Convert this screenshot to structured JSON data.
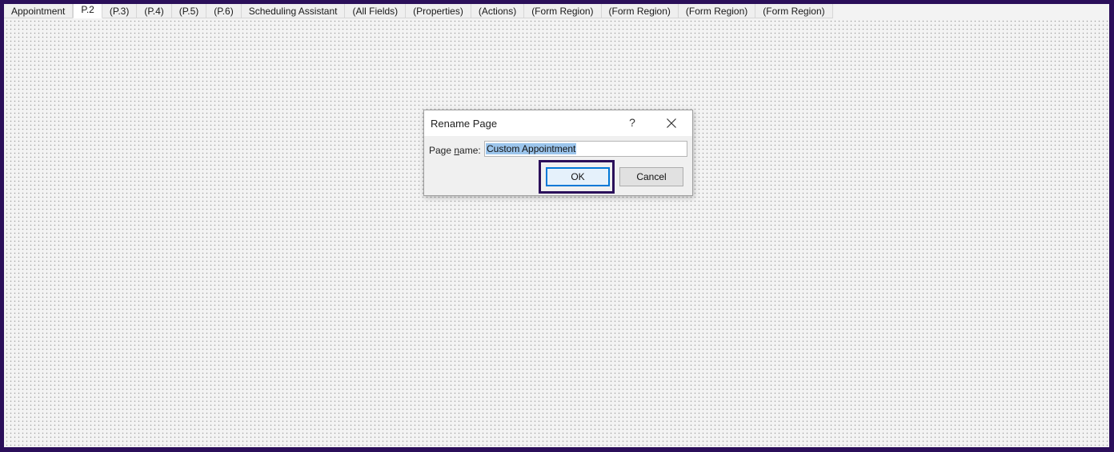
{
  "tabs": [
    {
      "label": "Appointment",
      "active": false
    },
    {
      "label": "P.2",
      "active": true
    },
    {
      "label": "(P.3)",
      "active": false
    },
    {
      "label": "(P.4)",
      "active": false
    },
    {
      "label": "(P.5)",
      "active": false
    },
    {
      "label": "(P.6)",
      "active": false
    },
    {
      "label": "Scheduling Assistant",
      "active": false
    },
    {
      "label": "(All Fields)",
      "active": false
    },
    {
      "label": "(Properties)",
      "active": false
    },
    {
      "label": "(Actions)",
      "active": false
    },
    {
      "label": "(Form Region)",
      "active": false
    },
    {
      "label": "(Form Region)",
      "active": false
    },
    {
      "label": "(Form Region)",
      "active": false
    },
    {
      "label": "(Form Region)",
      "active": false
    }
  ],
  "dialog": {
    "title": "Rename Page",
    "help_glyph": "?",
    "close_icon": "close-icon",
    "field_label_prefix": "Page ",
    "field_label_access": "n",
    "field_label_suffix": "ame:",
    "input_value": "Custom Appointment",
    "ok_label": "OK",
    "cancel_label": "Cancel"
  },
  "colors": {
    "frame_border": "#2b0f5a",
    "selection": "#9cc5ec",
    "ok_focus": "#0078d7"
  }
}
